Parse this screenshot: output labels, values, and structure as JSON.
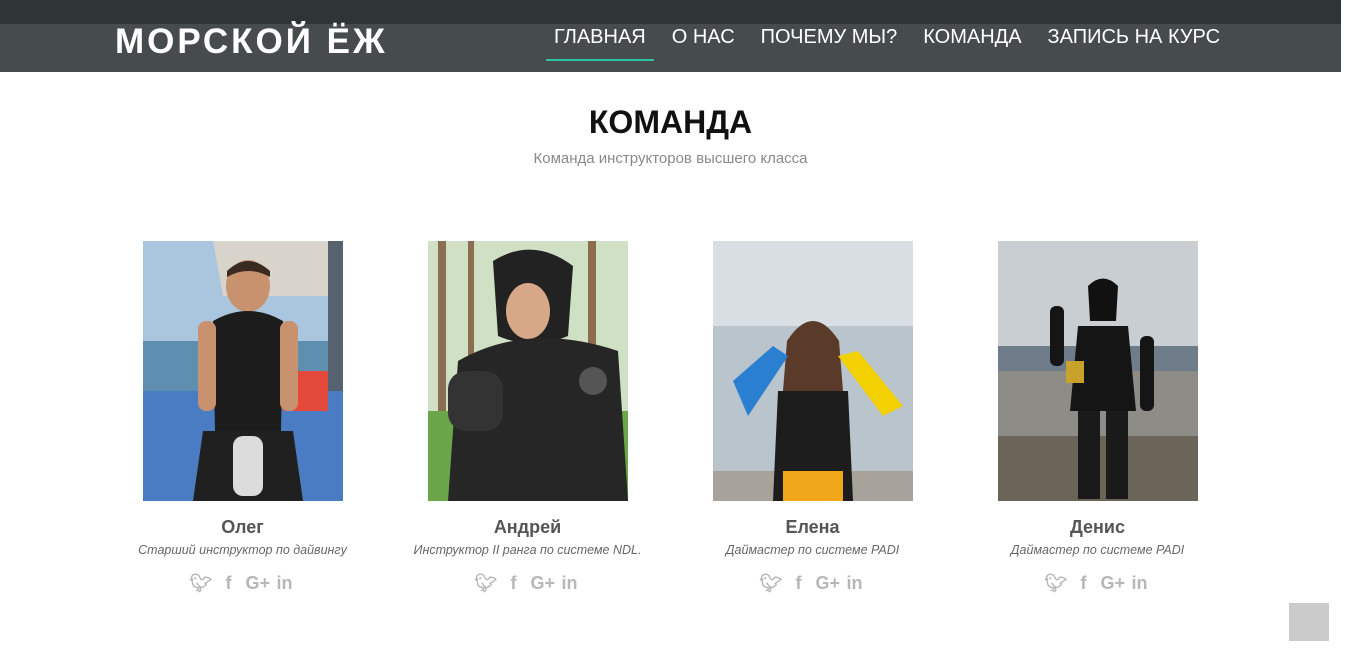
{
  "header": {
    "brand": "МОРСКОЙ ЁЖ",
    "nav": [
      "ГЛАВНАЯ",
      "О НАС",
      "ПОЧЕМУ МЫ?",
      "КОМАНДА",
      "ЗАПИСЬ НА КУРС"
    ]
  },
  "team": {
    "title": "КОМАНДА",
    "subtitle": "Команда инструкторов высшего класса",
    "members": [
      {
        "name": "Олег",
        "role": "Старший инструктор по дайвингу"
      },
      {
        "name": "Андрей",
        "role": "Инструктор II ранга по системе NDL."
      },
      {
        "name": "Елена",
        "role": "Даймастер по системе PADI"
      },
      {
        "name": "Денис",
        "role": "Даймастер по системе PADI"
      }
    ],
    "social": [
      "twitter-icon",
      "facebook-icon",
      "google-plus-icon",
      "linkedin-icon"
    ]
  },
  "colors": {
    "accent": "#2dc6a3",
    "navbar": "#464c4e"
  }
}
